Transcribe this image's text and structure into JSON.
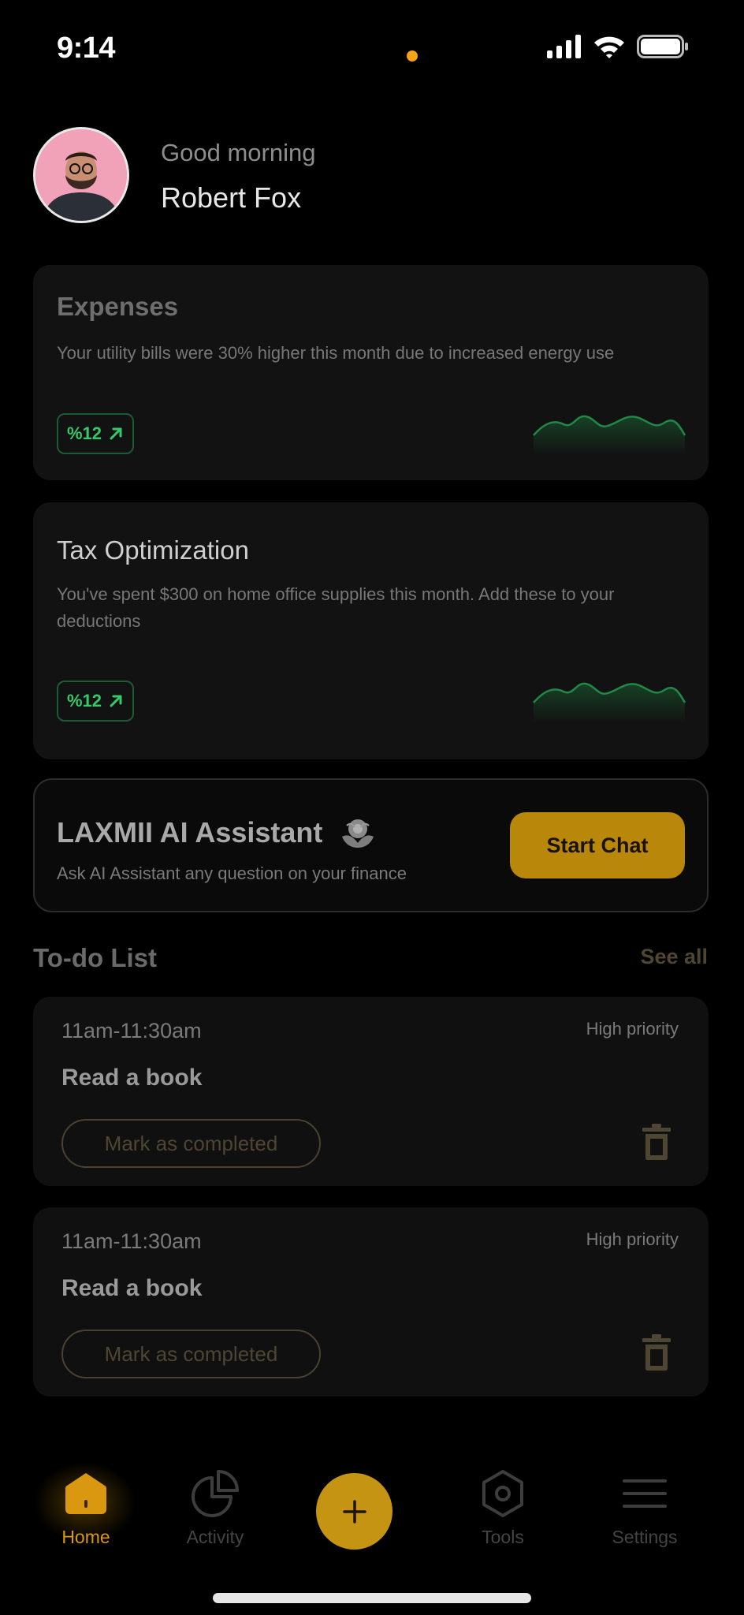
{
  "status_bar": {
    "time": "9:14"
  },
  "greeting": {
    "salutation": "Good morning",
    "name": "Robert Fox"
  },
  "insights": [
    {
      "title": "Expenses",
      "description": "Your utility bills were 30% higher this month due to increased energy use",
      "badge": "%12",
      "title_color": "#6e6e6e"
    },
    {
      "title": "Tax Optimization",
      "description": "You've spent $300 on home office supplies this month. Add these to your deductions",
      "badge": "%12",
      "title_color": "#cfcfcf"
    }
  ],
  "assistant": {
    "title": "LAXMII AI Assistant",
    "description": "Ask AI Assistant any question on your finance",
    "button_label": "Start Chat"
  },
  "todo": {
    "heading": "To-do List",
    "see_all": "See all",
    "items": [
      {
        "time": "11am-11:30am",
        "priority": "High priority",
        "title": "Read a book",
        "action": "Mark as completed"
      },
      {
        "time": "11am-11:30am",
        "priority": "High priority",
        "title": "Read a book",
        "action": "Mark as completed"
      }
    ]
  },
  "tabbar": {
    "items": [
      {
        "label": "Home",
        "icon": "home-icon",
        "active": true
      },
      {
        "label": "Activity",
        "icon": "pie-chart-icon",
        "active": false
      },
      {
        "label": "",
        "icon": "plus-icon",
        "active": false
      },
      {
        "label": "Tools",
        "icon": "hexagon-icon",
        "active": false
      },
      {
        "label": "Settings",
        "icon": "menu-icon",
        "active": false
      }
    ]
  },
  "colors": {
    "accent": "#c59412",
    "positive": "#36c96a",
    "background": "#000000",
    "card": "#121212"
  }
}
